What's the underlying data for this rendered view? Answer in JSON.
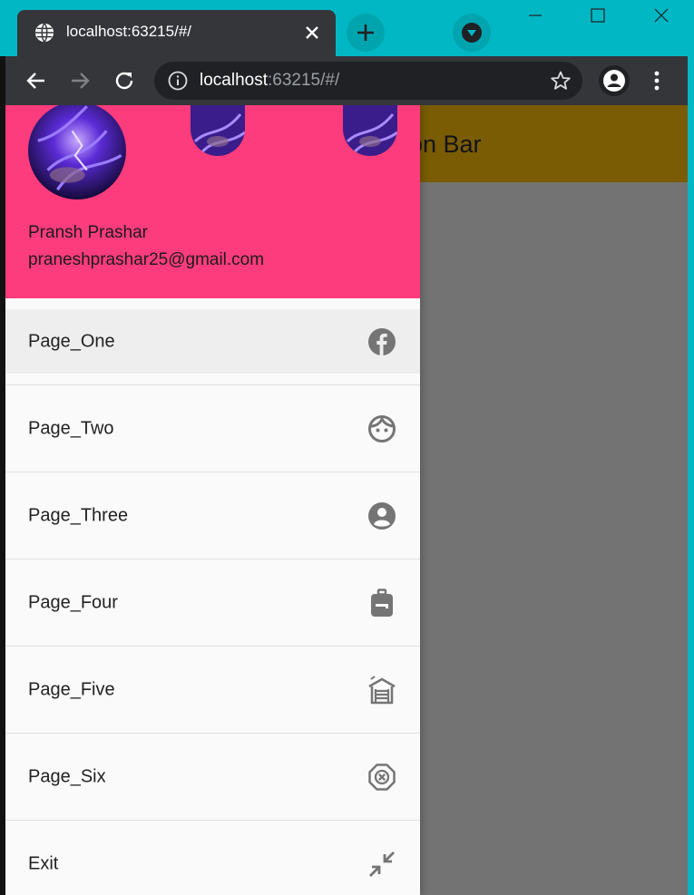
{
  "browser": {
    "tab_title": "localhost:63215/#/",
    "url_host": "localhost",
    "url_rest": ":63215/#/"
  },
  "app": {
    "appbar_title_partial": "on Bar"
  },
  "drawer": {
    "account_name": "Pransh Prashar",
    "account_email": "praneshprashar25@gmail.com",
    "items": [
      {
        "label": "Page_One",
        "icon": "facebook-icon"
      },
      {
        "label": "Page_Two",
        "icon": "face-icon"
      },
      {
        "label": "Page_Three",
        "icon": "account-circle-icon"
      },
      {
        "label": "Page_Four",
        "icon": "backpack-icon"
      },
      {
        "label": "Page_Five",
        "icon": "warehouse-icon"
      },
      {
        "label": "Page_Six",
        "icon": "cancel-octagon-icon"
      },
      {
        "label": "Exit",
        "icon": "close-fullscreen-icon"
      }
    ]
  },
  "colors": {
    "titlebar": "#00b7c3",
    "drawer_header": "#fc3c7c",
    "appbar": "#7a5c04",
    "scrim": "#737373"
  }
}
